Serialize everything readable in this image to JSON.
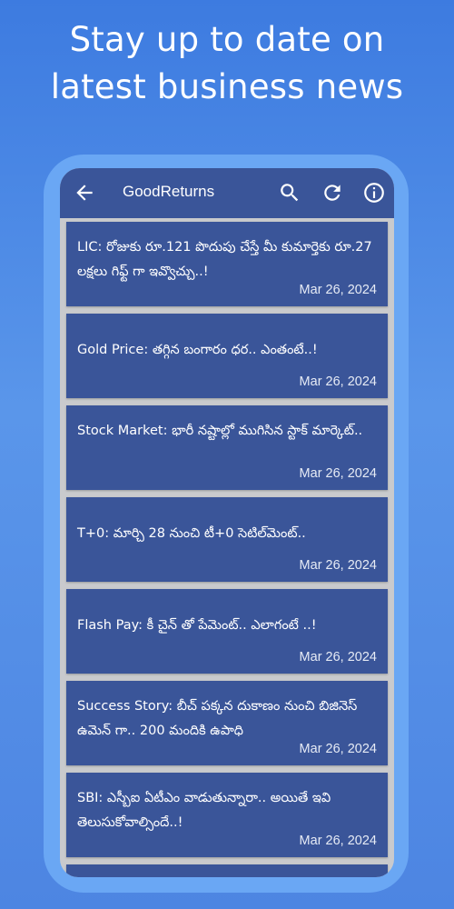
{
  "promo": {
    "line1": "Stay up to date on",
    "line2": "latest business news"
  },
  "appbar": {
    "title": "GoodReturns",
    "icons": [
      "back-arrow-icon",
      "search-icon",
      "refresh-icon",
      "info-icon"
    ]
  },
  "colors": {
    "background": "#4d85e2",
    "phone_frame": "#6aa7f4",
    "card": "#3a5599",
    "list_background": "#c9cacd"
  },
  "articles": [
    {
      "title": "LIC: రోజుకు రూ.121 పొదుపు చేస్తే మీ కుమార్తెకు రూ.27 లక్షలు గిఫ్ట్ గా ఇవ్వొచ్చు..!",
      "date": "Mar 26, 2024"
    },
    {
      "title": "Gold Price: తగ్గిన  బంగారం ధర.. ఎంతంటే..!",
      "date": "Mar 26, 2024"
    },
    {
      "title": "Stock Market: భారీ నష్టాల్లో ముగిసిన స్టాక్ మార్కెట్..",
      "date": "Mar 26, 2024"
    },
    {
      "title": "T+0: మార్చి 28 నుంచి టీ+0 సెటిల్‌మెంట్..",
      "date": "Mar 26, 2024"
    },
    {
      "title": "Flash Pay: కీ చైన్ తో పేమెంట్.. ఎలాగంటే ..!",
      "date": "Mar 26, 2024"
    },
    {
      "title": "Success Story: బీచ్ పక్కన దుకాణం నుంచి బిజినెస్ ఉమెన్ గా..  200 మందికి ఉపాధి",
      "date": "Mar 26, 2024"
    },
    {
      "title": "SBI: ఎస్బీఐ ఏటీఎం వాడుతున్నారా.. అయితే ఇవి తెలుసుకోవాల్సిందే..!",
      "date": "Mar 26, 2024"
    }
  ]
}
